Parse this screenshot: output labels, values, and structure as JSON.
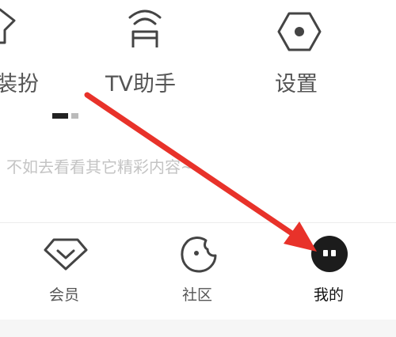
{
  "top_menu": {
    "items": [
      {
        "label": "装扮",
        "icon": "shirt-icon"
      },
      {
        "label": "TV助手",
        "icon": "tv-cast-icon"
      },
      {
        "label": "设置",
        "icon": "hexagon-settings-icon"
      }
    ]
  },
  "content": {
    "empty_message": "不如去看看其它精彩内容~"
  },
  "bottom_nav": {
    "items": [
      {
        "label": "会员",
        "icon": "diamond-icon",
        "active": false
      },
      {
        "label": "社区",
        "icon": "community-icon",
        "active": false
      },
      {
        "label": "我的",
        "icon": "mine-icon",
        "active": true
      }
    ]
  },
  "annotation": {
    "arrow_color": "#e8322a"
  },
  "colors": {
    "text": "#555555",
    "active": "#1c1c1c",
    "divider": "#ececec"
  }
}
